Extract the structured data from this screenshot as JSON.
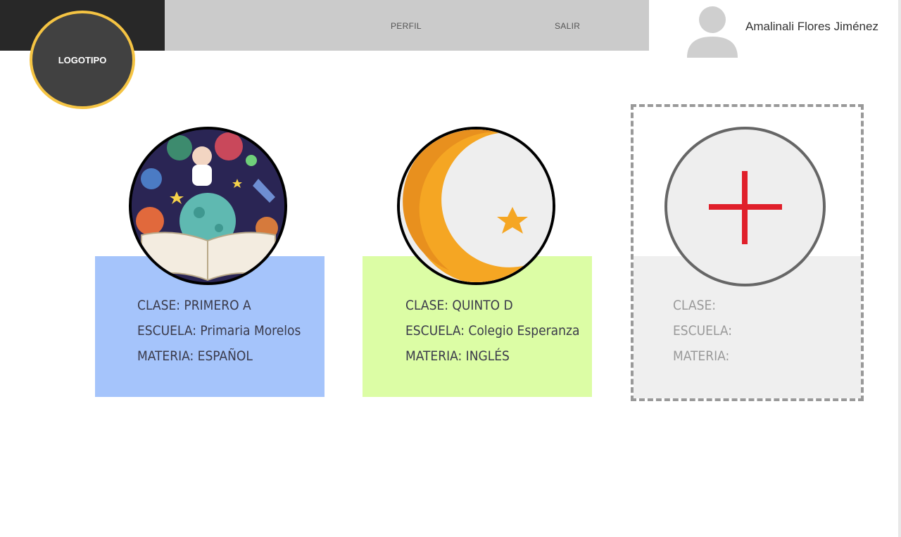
{
  "header": {
    "logo_text": "LOGOTIPO",
    "nav": {
      "profile": "PERFIL",
      "logout": "SALIR"
    },
    "user_name": "Amalinali Flores Jiménez",
    "avatar_icon": "user-silhouette-icon"
  },
  "cards": [
    {
      "image_icon": "astronaut-book-illustration",
      "color": "#a5c4fb",
      "class_line": "CLASE: PRIMERO A",
      "school_line": "ESCUELA: Primaria Morelos",
      "subject_line": "MATERIA: ESPAÑOL"
    },
    {
      "image_icon": "crescent-moon-star-icon",
      "color": "#dcfda5",
      "class_line": "CLASE: QUINTO D",
      "school_line": "ESCUELA: Colegio Esperanza",
      "subject_line": "MATERIA: INGLÉS"
    }
  ],
  "new_card": {
    "icon": "plus-icon",
    "class_label": "CLASE:",
    "school_label": "ESCUELA:",
    "subject_label": "MATERIA:"
  },
  "colors": {
    "logo_ring": "#f5c443",
    "plus": "#e01f2a"
  }
}
